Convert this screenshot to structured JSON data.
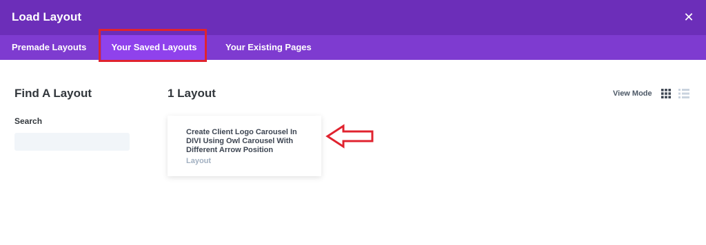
{
  "header": {
    "title": "Load Layout",
    "close_label": "✕"
  },
  "tabs": [
    {
      "label": "Premade Layouts",
      "active": false
    },
    {
      "label": "Your Saved Layouts",
      "active": true
    },
    {
      "label": "Your Existing Pages",
      "active": false
    }
  ],
  "sidebar": {
    "title": "Find A Layout",
    "search_label": "Search",
    "search_value": "",
    "search_placeholder": ""
  },
  "main": {
    "results_count": "1 Layout",
    "view_mode_label": "View Mode",
    "view_mode_options": [
      "grid-icon",
      "list-icon"
    ],
    "layouts": [
      {
        "title": "Create Client Logo Carousel In DIVI Using Owl Carousel With Different Arrow Position",
        "type": "Layout"
      }
    ]
  },
  "colors": {
    "header_bg": "#6c2eb9",
    "tab_bar_bg": "#7e3bd0",
    "active_tab_bg": "#8f42ec",
    "annotation_red": "#e0232f"
  }
}
